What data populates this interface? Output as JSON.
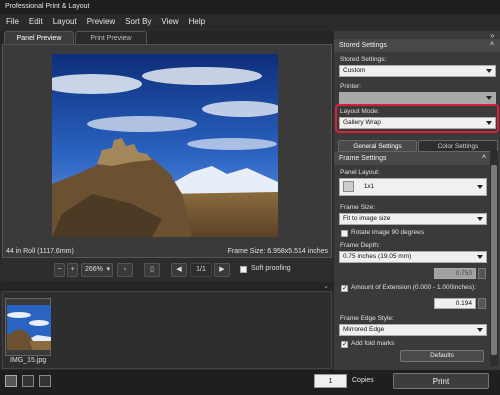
{
  "window": {
    "title": "Professional Print & Layout"
  },
  "menu": [
    "File",
    "Edit",
    "Layout",
    "Preview",
    "Sort By",
    "View",
    "Help"
  ],
  "tabs": {
    "panel_preview": "Panel Preview",
    "print_preview": "Print Preview"
  },
  "status": {
    "roll": "44 in Roll (1117.6mm)",
    "frame_size": "Frame Size: 6.958x5.514 inches"
  },
  "toolbar": {
    "zoom": "266%",
    "page": "1/1",
    "soft_proofing": "Soft proofing"
  },
  "filmstrip": {
    "thumb_label": "IMG_15.jpg"
  },
  "bottom": {
    "copies_value": "1",
    "copies_label": "Copies",
    "print_button": "Print"
  },
  "panel": {
    "stored_settings_header": "Stored Settings",
    "stored_settings_label": "Stored Settings:",
    "stored_settings_value": "Custom",
    "printer_label": "Printer:",
    "printer_value": "",
    "layout_mode_label": "Layout Mode:",
    "layout_mode_value": "Gallery Wrap",
    "tab_general": "General Settings",
    "tab_color": "Color Settings",
    "frame_settings_header": "Frame Settings",
    "panel_layout_label": "Panel Layout:",
    "panel_layout_value": "1x1",
    "frame_size_label": "Frame Size:",
    "frame_size_value": "Fit to image size",
    "rotate_label": "Rotate image 90 degrees",
    "frame_depth_label": "Frame Depth:",
    "frame_depth_value": "0.75 inches (19.05 mm)",
    "frame_depth_num": "0.750",
    "extension_label": "Amount of Extension (0.000 - 1.000inches):",
    "extension_value": "0.194",
    "edge_style_label": "Frame Edge Style:",
    "edge_style_value": "Mirrored Edge",
    "fold_marks_label": "Add fold marks",
    "defaults_button": "Defaults"
  },
  "colors": {
    "highlight": "#d9203a",
    "panel_bg": "#3a3a3a",
    "app_bg": "#2b2b2b"
  },
  "icons": [
    "zoom-out-icon",
    "zoom-in-icon",
    "paper-icon",
    "page-icon",
    "prev-icon",
    "next-icon",
    "expand-panel-icon",
    "collapse-icon",
    "view-single-icon",
    "view-split-icon",
    "view-grid-icon"
  ]
}
